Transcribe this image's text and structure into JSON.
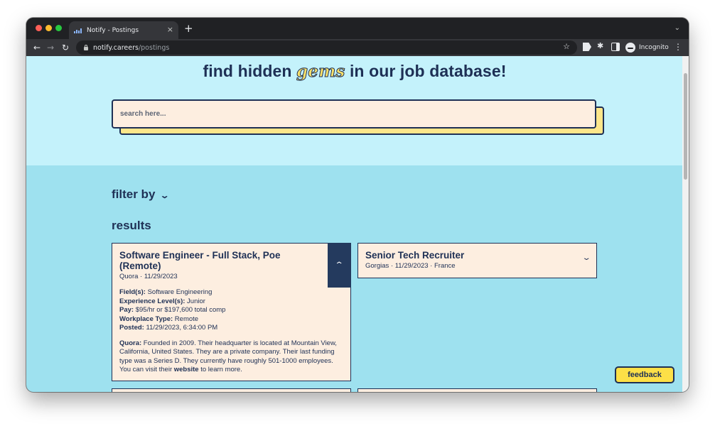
{
  "browser": {
    "tab_title": "Notify - Postings",
    "tab_close": "×",
    "new_tab": "+",
    "tab_menu": "⌄",
    "url_domain": "notify.careers",
    "url_path": "/postings",
    "profile_label": "Incognito",
    "icons": {
      "back": "arrow-left",
      "forward": "arrow-right",
      "reload": "reload",
      "lock": "lock",
      "bookmark": "star",
      "extension_tag": "tag",
      "extensions": "puzzle",
      "side_panel": "side-panel",
      "menu": "kebab"
    }
  },
  "hero": {
    "headline_before": "find hidden ",
    "headline_highlight": "gems",
    "headline_after": " in our job database!",
    "search_placeholder": "search here..."
  },
  "filters": {
    "label": "filter by",
    "chevron": "⌄"
  },
  "results": {
    "heading": "results",
    "cards": [
      {
        "title": "Software Engineer - Full Stack, Poe (Remote)",
        "meta": "Quora · 11/29/2023",
        "expanded": true,
        "toggle": "⌃",
        "details": [
          {
            "label": "Field(s):",
            "value": "Software Engineering"
          },
          {
            "label": "Experience Level(s):",
            "value": "Junior"
          },
          {
            "label": "Pay:",
            "value": "$95/hr or $197,600 total comp"
          },
          {
            "label": "Workplace Type:",
            "value": "Remote"
          },
          {
            "label": "Posted:",
            "value": "11/29/2023, 6:34:00 PM"
          }
        ],
        "company_label": "Quora:",
        "company_text": "Founded in 2009. Their headquarter is located at Mountain View, California, United States. They are a private company. Their last funding type was a Series D. They currently have roughly 501-1000 employees. You can visit their",
        "website_link": "website",
        "company_tail": "to learn more."
      },
      {
        "title": "Senior Tech Recruiter",
        "meta": "Gorgias · 11/29/2023 · France",
        "expanded": false,
        "toggle": "⌄"
      }
    ]
  },
  "feedback_label": "feedback",
  "colors": {
    "navy": "#1e3055",
    "hero_bg": "#c4f2fb",
    "main_bg": "#9ee1ef",
    "card_bg": "#fdeee0",
    "accent_yellow": "#fde047"
  }
}
